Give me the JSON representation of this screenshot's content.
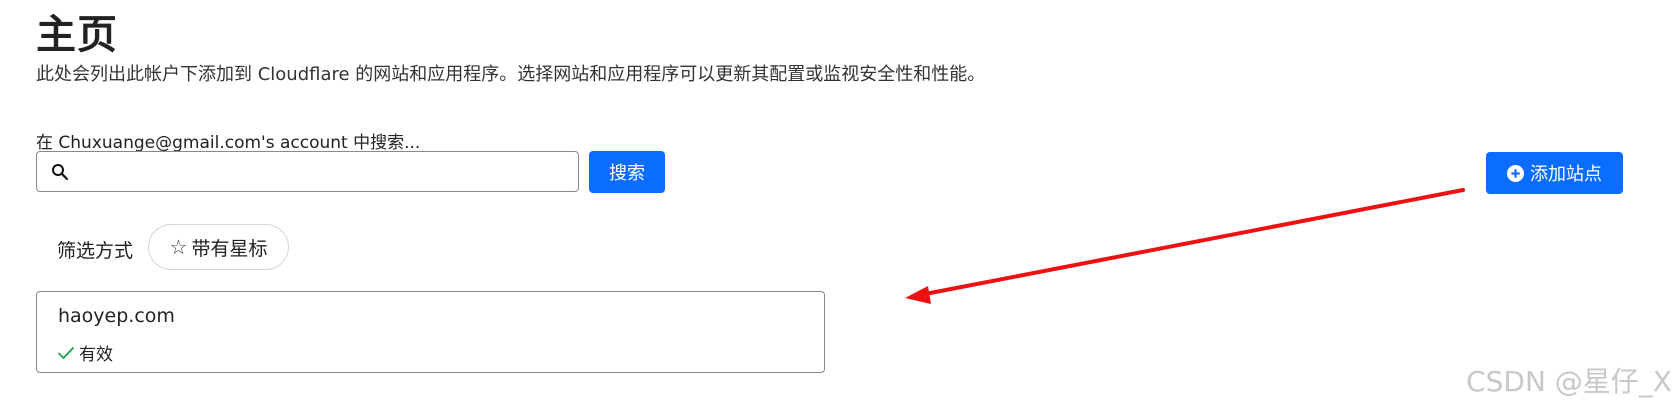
{
  "header": {
    "title": "主页",
    "subtitle": "此处会列出此帐户下添加到 Cloudflare 的网站和应用程序。选择网站和应用程序可以更新其配置或监视安全性和性能。"
  },
  "search": {
    "label": "在 Chuxuange@gmail.com's account 中搜索...",
    "value": "",
    "placeholder": "",
    "button_label": "搜索",
    "icon": "search-icon"
  },
  "actions": {
    "add_site_label": "添加站点",
    "add_icon": "plus-circle-icon",
    "primary_color": "#0b6dff"
  },
  "filter": {
    "label": "筛选方式",
    "chip_label": "带有星标",
    "chip_icon": "star-outline-icon"
  },
  "sites": [
    {
      "name": "haoyep.com",
      "status": "有效",
      "status_icon": "check-icon",
      "status_color": "#1aa04b"
    }
  ],
  "annotation": {
    "arrow_color": "#ee1111"
  },
  "watermark": "CSDN @星仔_X"
}
